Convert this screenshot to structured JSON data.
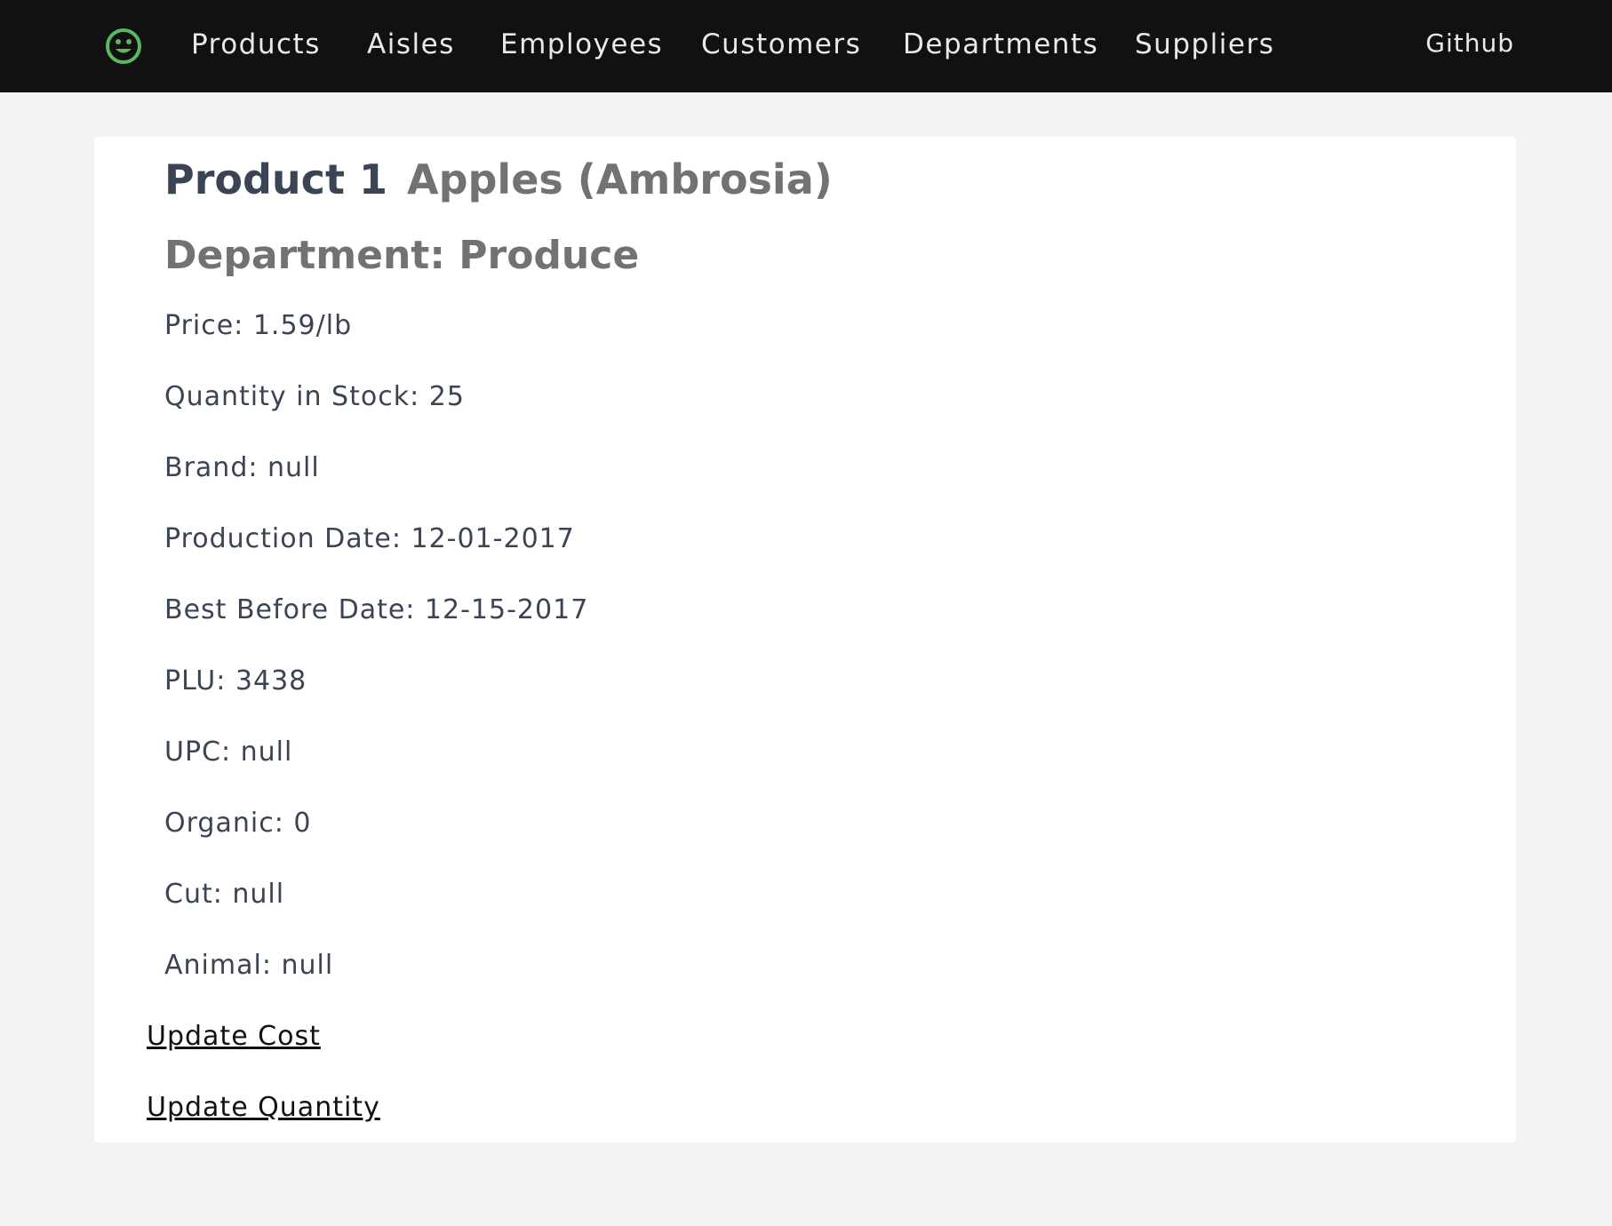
{
  "colors": {
    "navbar_bg": "#111111",
    "page_bg": "#f2f3f5",
    "logo_green": "#5cb85c",
    "title_dark": "#3b4454",
    "title_gray": "#727272"
  },
  "navbar": {
    "logo_icon": "smiley-face-icon",
    "items": [
      {
        "label": "Products"
      },
      {
        "label": "Aisles"
      },
      {
        "label": "Employees"
      },
      {
        "label": "Customers"
      },
      {
        "label": "Departments"
      },
      {
        "label": "Suppliers"
      }
    ],
    "github_label": "Github"
  },
  "product": {
    "title": "Product 1",
    "name": "Apples (Ambrosia)",
    "department": "Department: Produce",
    "fields": [
      {
        "text": "Price: 1.59/lb"
      },
      {
        "text": "Quantity in Stock: 25"
      },
      {
        "text": "Brand: null"
      },
      {
        "text": "Production Date: 12-01-2017"
      },
      {
        "text": "Best Before Date: 12-15-2017"
      },
      {
        "text": "PLU: 3438"
      },
      {
        "text": "UPC: null"
      },
      {
        "text": "Organic: 0"
      },
      {
        "text": "Cut: null"
      },
      {
        "text": "Animal: null"
      }
    ]
  },
  "actions": {
    "update_cost": "Update Cost",
    "update_quantity": "Update Quantity"
  }
}
